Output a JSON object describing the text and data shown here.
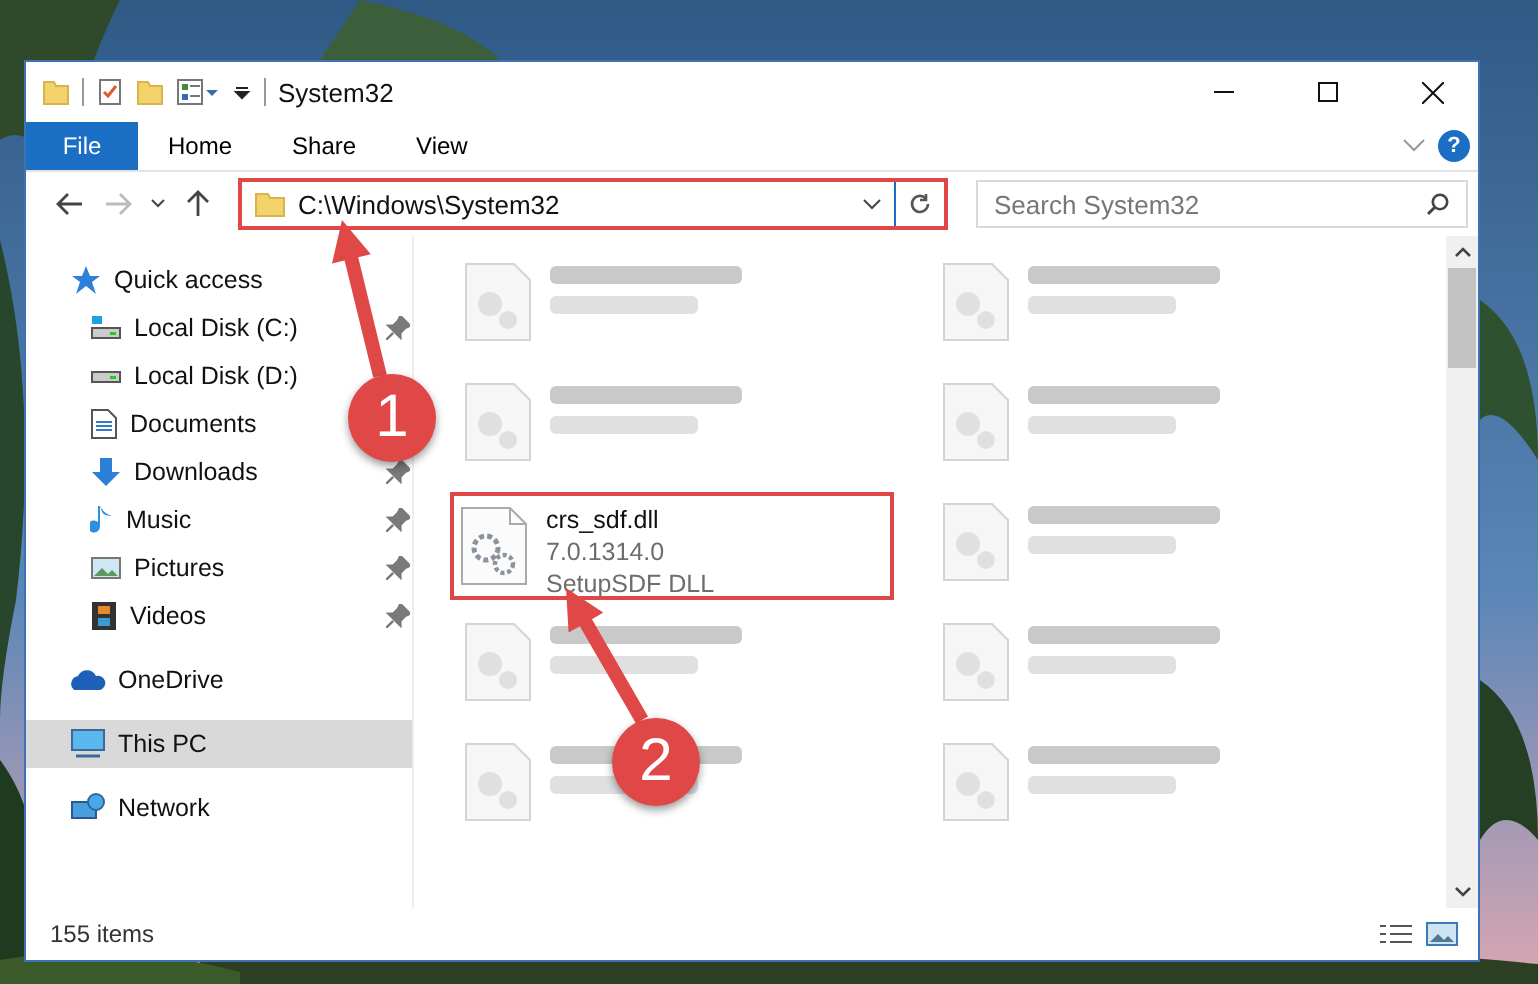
{
  "window": {
    "title": "System32"
  },
  "ribbon": {
    "tabs": [
      {
        "label": "File",
        "kind": "menu",
        "selected": false
      },
      {
        "label": "Home",
        "kind": "tab",
        "selected": false
      },
      {
        "label": "Share",
        "kind": "tab",
        "selected": false
      },
      {
        "label": "View",
        "kind": "tab",
        "selected": false
      }
    ],
    "help": "?"
  },
  "address_bar": {
    "path": "C:\\Windows\\System32",
    "highlighted": true
  },
  "search": {
    "placeholder": "Search System32"
  },
  "sidebar": {
    "items": [
      {
        "label": "Quick access",
        "selected": false,
        "children": [
          {
            "label": "Local Disk (C:)",
            "selected": false,
            "pinned": true
          },
          {
            "label": "Local Disk (D:)",
            "selected": false,
            "pinned": false
          },
          {
            "label": "Documents",
            "selected": false,
            "pinned": false
          },
          {
            "label": "Downloads",
            "selected": false,
            "pinned": true
          },
          {
            "label": "Music",
            "selected": false,
            "pinned": true
          },
          {
            "label": "Pictures",
            "selected": false,
            "pinned": true
          },
          {
            "label": "Videos",
            "selected": false,
            "pinned": true
          }
        ]
      },
      {
        "label": "OneDrive",
        "selected": false
      },
      {
        "label": "This PC",
        "selected": true
      },
      {
        "label": "Network",
        "selected": false
      }
    ]
  },
  "files": [
    {
      "kind": "blurred"
    },
    {
      "kind": "blurred"
    },
    {
      "kind": "blurred"
    },
    {
      "kind": "blurred"
    },
    {
      "kind": "file",
      "name": "crs_sdf.dll",
      "details": [
        "7.0.1314.0",
        "SetupSDF DLL"
      ],
      "highlighted": true
    },
    {
      "kind": "blurred"
    },
    {
      "kind": "blurred"
    },
    {
      "kind": "blurred"
    },
    {
      "kind": "blurred"
    },
    {
      "kind": "blurred"
    }
  ],
  "status_bar": {
    "item_count": "155 items"
  },
  "callouts": [
    {
      "number": "1"
    },
    {
      "number": "2"
    }
  ]
}
